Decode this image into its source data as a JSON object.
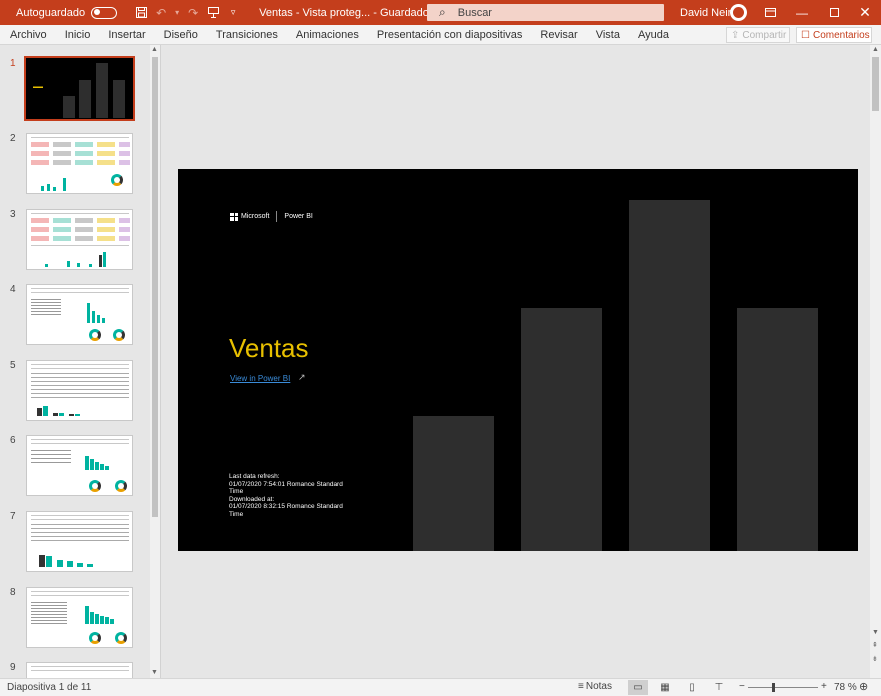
{
  "titlebar": {
    "autosave_label": "Autoguardado",
    "doc_title": "Ventas  -  Vista proteg...  -  Guardado en Este PC",
    "search_placeholder": "Buscar",
    "user_name": "David Neira",
    "icons": [
      "save-icon",
      "undo-icon",
      "redo-icon",
      "present-icon",
      "customize-icon"
    ]
  },
  "ribbon": {
    "tabs": [
      "Archivo",
      "Inicio",
      "Insertar",
      "Diseño",
      "Transiciones",
      "Animaciones",
      "Presentación con diapositivas",
      "Revisar",
      "Vista",
      "Ayuda"
    ],
    "share_label": "Compartir",
    "comments_label": "Comentarios"
  },
  "thumbnails": {
    "numbers": [
      "1",
      "2",
      "3",
      "4",
      "5",
      "6",
      "7",
      "8",
      "9"
    ],
    "active_index": 1
  },
  "slide": {
    "brand_microsoft": "Microsoft",
    "brand_product": "Power BI",
    "title": "Ventas",
    "link_text": "View in Power BI",
    "refresh_label": "Last data refresh:",
    "refresh_value": "01/07/2020 7:54:01 Romance Standard Time",
    "downloaded_label": "Downloaded at:",
    "downloaded_value": "01/07/2020 8:32:15 Romance Standard Time"
  },
  "status": {
    "slide_counter": "Diapositiva 1 de 11",
    "notes_label": "Notas",
    "zoom_level": "78 %",
    "zoom_percent": 78
  },
  "colors": {
    "accent": "#c43e1c",
    "title_yellow": "#e8c000",
    "link_blue": "#3a8bd8",
    "chart_teal": "#00b3a0"
  }
}
